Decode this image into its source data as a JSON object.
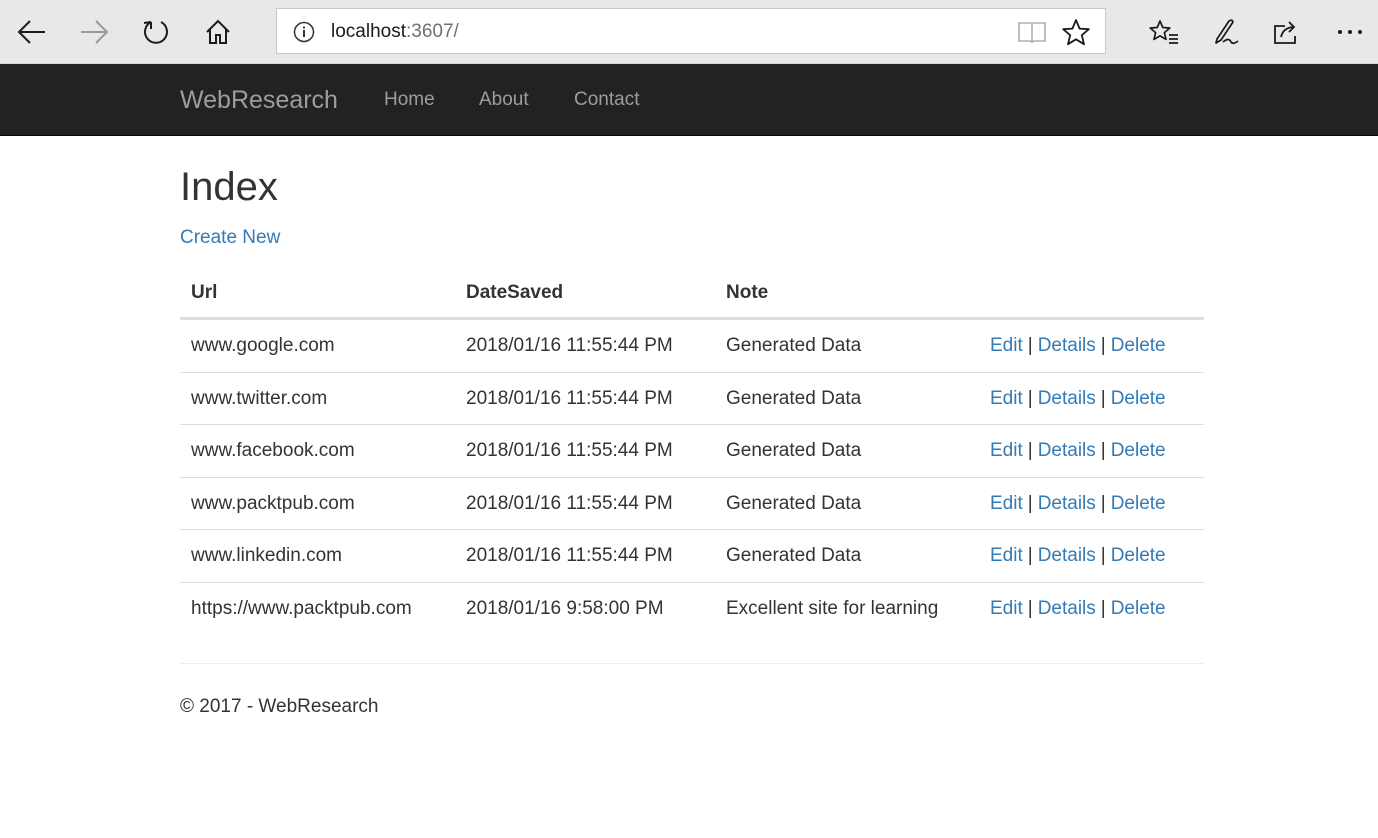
{
  "browser": {
    "address": {
      "host": "localhost",
      "rest": ":3607/"
    },
    "icons": {
      "back": "back-arrow-icon",
      "forward": "forward-arrow-icon",
      "refresh": "refresh-icon",
      "home": "home-icon",
      "info": "info-icon",
      "reading_view": "reading-view-icon",
      "favorite": "star-icon",
      "favorites_hub": "favorites-list-icon",
      "notes": "pen-icon",
      "share": "share-icon",
      "more": "more-icon"
    }
  },
  "navbar": {
    "brand": "WebResearch",
    "links": [
      "Home",
      "About",
      "Contact"
    ],
    "bg_color": "#222222",
    "link_color": "#9d9d9d"
  },
  "page": {
    "title": "Index",
    "create_link": "Create New",
    "link_color": "#337ab7"
  },
  "table": {
    "headers": [
      "Url",
      "DateSaved",
      "Note"
    ],
    "rows": [
      {
        "url": "www.google.com",
        "date": "2018/01/16 11:55:44 PM",
        "note": "Generated Data"
      },
      {
        "url": "www.twitter.com",
        "date": "2018/01/16 11:55:44 PM",
        "note": "Generated Data"
      },
      {
        "url": "www.facebook.com",
        "date": "2018/01/16 11:55:44 PM",
        "note": "Generated Data"
      },
      {
        "url": "www.packtpub.com",
        "date": "2018/01/16 11:55:44 PM",
        "note": "Generated Data"
      },
      {
        "url": "www.linkedin.com",
        "date": "2018/01/16 11:55:44 PM",
        "note": "Generated Data"
      },
      {
        "url": "https://www.packtpub.com",
        "date": "2018/01/16 9:58:00 PM",
        "note": "Excellent site for learning"
      }
    ],
    "actions": {
      "edit": "Edit",
      "details": "Details",
      "delete": "Delete",
      "separator": "|"
    }
  },
  "footer": {
    "text": "© 2017 - WebResearch"
  }
}
